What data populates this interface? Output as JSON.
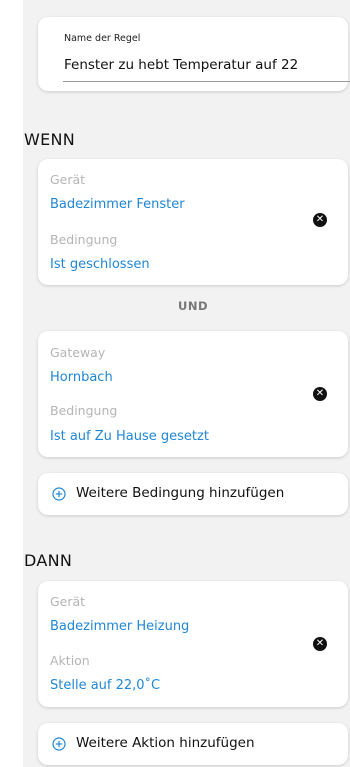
{
  "rule_name": {
    "label": "Name der Regel",
    "value": "Fenster zu hebt Temperatur auf 22"
  },
  "if_section": {
    "title": "WENN",
    "conditions": [
      {
        "source_label": "Gerät",
        "source_value": "Badezimmer Fenster",
        "condition_label": "Bedingung",
        "condition_value": "Ist geschlossen"
      },
      {
        "source_label": "Gateway",
        "source_value": "Hornbach",
        "condition_label": "Bedingung",
        "condition_value": "Ist auf Zu Hause gesetzt"
      }
    ],
    "connector": "UND",
    "add_button_label": "Weitere Bedingung hinzufügen"
  },
  "then_section": {
    "title": "DANN",
    "actions": [
      {
        "source_label": "Gerät",
        "source_value": "Badezimmer Heizung",
        "action_label": "Aktion",
        "action_value": "Stelle auf 22,0˚C"
      }
    ],
    "add_button_label": "Weitere Aktion hinzufügen"
  },
  "icons": {
    "remove": "close-circle-icon",
    "add": "plus-circle-icon"
  },
  "colors": {
    "accent": "#1f87d6",
    "background": "#f2f2f2",
    "card": "#ffffff",
    "label_gray": "#b5b5b5"
  }
}
